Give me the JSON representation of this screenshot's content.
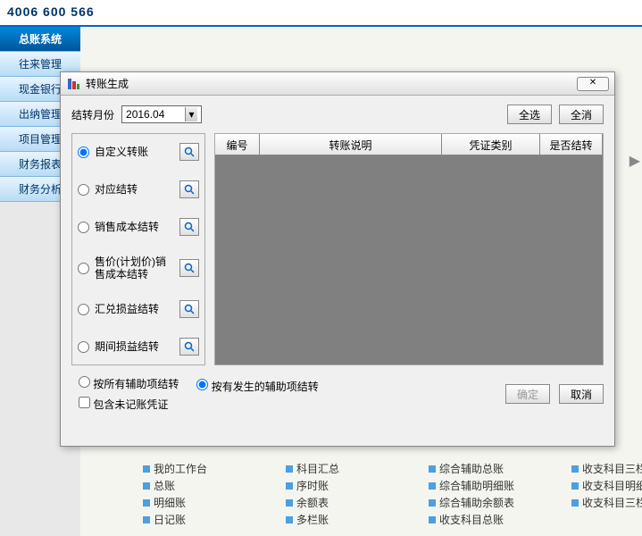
{
  "banner": {
    "phone": "4006 600 566"
  },
  "sidebar": {
    "items": [
      {
        "label": "总账系统",
        "active": true
      },
      {
        "label": "往来管理"
      },
      {
        "label": "现金银行"
      },
      {
        "label": "出纳管理"
      },
      {
        "label": "项目管理"
      },
      {
        "label": "财务报表"
      },
      {
        "label": "财务分析"
      }
    ]
  },
  "dialog": {
    "title": "转账生成",
    "month_label": "结转月份",
    "month_value": "2016.04",
    "select_all": "全选",
    "select_none": "全消",
    "radios": [
      {
        "label": "自定义转账",
        "checked": true
      },
      {
        "label": "对应结转"
      },
      {
        "label": "销售成本结转"
      },
      {
        "label": "售价(计划价)销售成本结转"
      },
      {
        "label": "汇兑损益结转"
      },
      {
        "label": "期间损益结转"
      }
    ],
    "grid_headers": [
      "编号",
      "转账说明",
      "凭证类别",
      "是否结转"
    ],
    "opt_all_aux": "按所有辅助项结转",
    "opt_occur_aux": "按有发生的辅助项结转",
    "opt_include_unposted": "包含未记账凭证",
    "ok": "确定",
    "cancel": "取消"
  },
  "links": {
    "col1": [
      "我的工作台",
      "总账",
      "明细账",
      "日记账"
    ],
    "col2": [
      "科目汇总",
      "序时账",
      "余额表",
      "多栏账"
    ],
    "col3": [
      "综合辅助总账",
      "综合辅助明细账",
      "综合辅助余额表",
      "收支科目总账"
    ],
    "col4": [
      "收支科目三栏式总账",
      "收支科目明细账",
      "收支科目三栏式明细账"
    ]
  }
}
